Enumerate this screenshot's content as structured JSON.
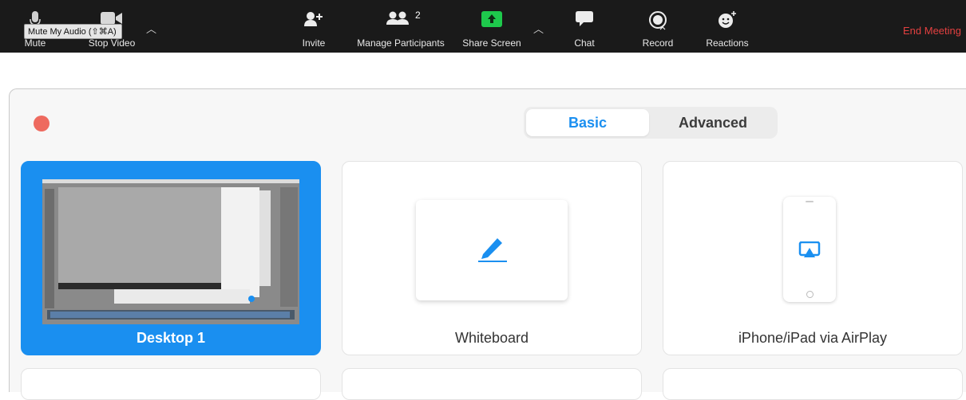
{
  "toolbar": {
    "tooltip": "Mute My Audio (⇧⌘A)",
    "mute_label": "Mute",
    "stop_video_label": "Stop Video",
    "invite_label": "Invite",
    "participants_label": "Manage Participants",
    "participants_count": "2",
    "share_label": "Share Screen",
    "chat_label": "Chat",
    "record_label": "Record",
    "reactions_label": "Reactions",
    "end_label": "End Meeting"
  },
  "share": {
    "tabs": {
      "basic": "Basic",
      "advanced": "Advanced"
    },
    "tiles": {
      "desktop": "Desktop 1",
      "whiteboard": "Whiteboard",
      "airplay": "iPhone/iPad via AirPlay"
    }
  },
  "colors": {
    "accent": "#1a8ff0",
    "end_meeting": "#e34040",
    "share_green": "#1ec94c",
    "close_red": "#ee6a5f"
  }
}
